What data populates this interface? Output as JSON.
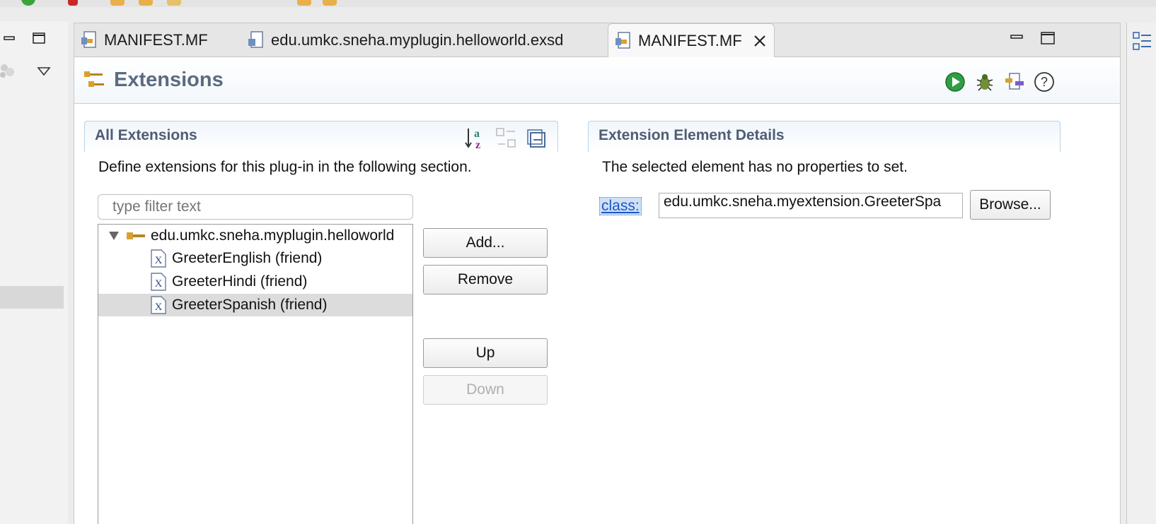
{
  "editor": {
    "tabs": [
      {
        "label": "MANIFEST.MF",
        "active": false
      },
      {
        "label": "edu.umkc.sneha.myplugin.helloworld.exsd",
        "active": false
      },
      {
        "label": "MANIFEST.MF",
        "active": true
      }
    ]
  },
  "form": {
    "title": "Extensions"
  },
  "all_extensions": {
    "title": "All Extensions",
    "description": "Define extensions for this plug-in in the following section.",
    "filter_placeholder": "type filter text",
    "tree": {
      "root": "edu.umkc.sneha.myplugin.helloworld",
      "children": [
        {
          "label": "GreeterEnglish (friend)",
          "selected": false
        },
        {
          "label": "GreeterHindi (friend)",
          "selected": false
        },
        {
          "label": "GreeterSpanish (friend)",
          "selected": true
        }
      ]
    },
    "buttons": {
      "add": "Add...",
      "remove": "Remove",
      "up": "Up",
      "down": "Down"
    }
  },
  "details": {
    "title": "Extension Element Details",
    "description": "The selected element has no properties to set.",
    "class_label": "class:",
    "class_value": "edu.umkc.sneha.myextension.GreeterSpa",
    "browse_label": "Browse..."
  },
  "colors": {
    "section_title": "#4e5d73",
    "form_title": "#5a6b82",
    "link": "#1b56c8",
    "selection": "#dcdcdc"
  }
}
